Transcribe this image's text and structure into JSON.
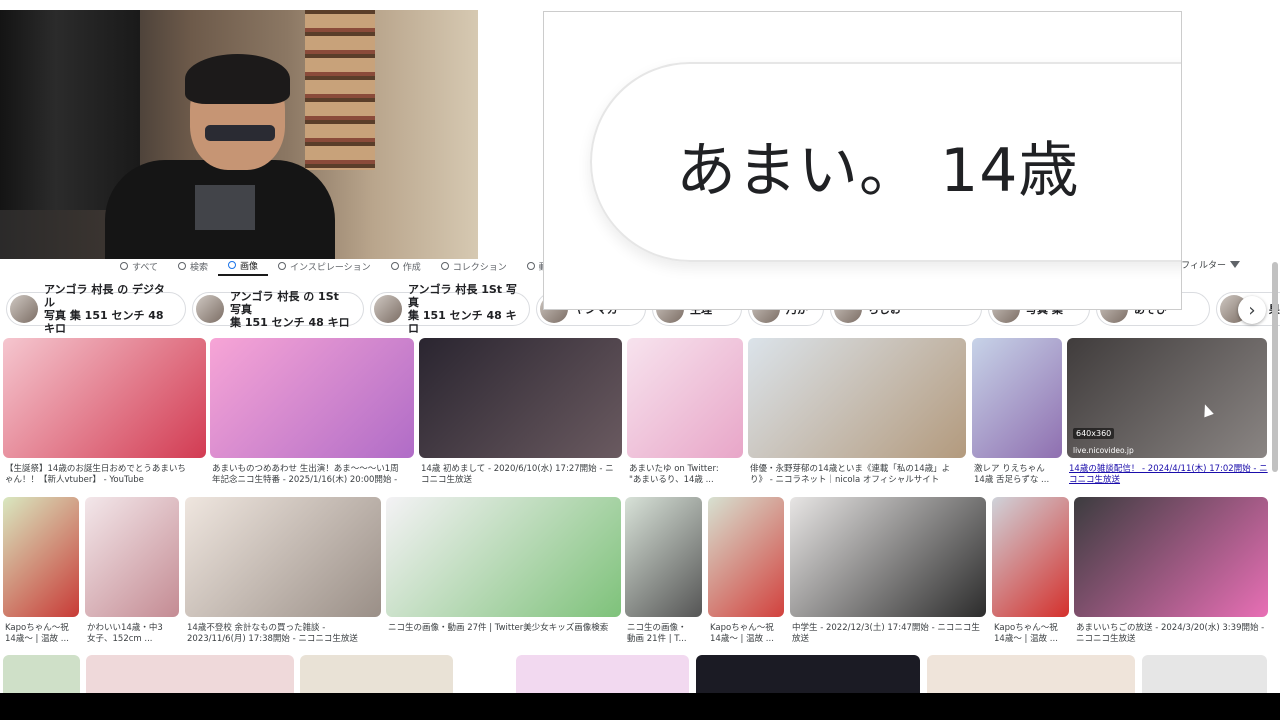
{
  "search_tabs": [
    {
      "label": "すべて",
      "icon": "search-icon"
    },
    {
      "label": "検索",
      "icon": "search-icon"
    },
    {
      "label": "画像",
      "icon": "image-icon",
      "active": true
    },
    {
      "label": "インスピレーション",
      "icon": "sparkle-icon"
    },
    {
      "label": "作成",
      "icon": "create-icon"
    },
    {
      "label": "コレクション",
      "icon": "collection-icon"
    },
    {
      "label": "動画",
      "icon": "video-icon"
    }
  ],
  "filters_label": "フィルター",
  "chips": [
    "アンゴラ 村長 の デジタル\n写真 集 151 センチ 48 キロ",
    "アンゴラ 村長 の 1St 写真\n集 151 センチ 48 キロ",
    "アンゴラ 村長 1St 写真\n集 151 センチ 48 キロ",
    "ヤンマガ",
    "生理",
    "乃か",
    "らじお",
    "写真 集",
    "あそび",
    "梨 果実"
  ],
  "row1": [
    {
      "caption": "【生誕祭】14歳のお誕生日おめでとうあまいち\nゃん！！【新人vtuber】 - YouTube",
      "colors": [
        "#f5c6cf",
        "#d23b52"
      ]
    },
    {
      "caption": "あまいものつめあわせ 生出演！あま〜〜〜い1周\n年記念ニコ生特番 - 2025/1/16(木) 20:00開始 -",
      "colors": [
        "#f7a5d6",
        "#b06cc7"
      ]
    },
    {
      "caption": "14歳 初めまして - 2020/6/10(水) 17:27開始 - ニ\nコニコ生放送",
      "colors": [
        "#2a2530",
        "#6a5a60"
      ]
    },
    {
      "caption": "あまいたゆ on Twitter:\n\"あまいるり、14歳 ...",
      "colors": [
        "#f7e3ee",
        "#e8a6c8"
      ]
    },
    {
      "caption": "俳優・永野芽郁の14歳といま《連載「私の14歳」よ\nり》 - ニコラネット｜nicola オフィシャルサイト",
      "colors": [
        "#dbe3ea",
        "#b39a7d"
      ]
    },
    {
      "caption": "激レア りえちゃん\n14歳 舌足らずな ...",
      "colors": [
        "#c7d3e8",
        "#8f6fb0"
      ]
    },
    {
      "caption": "14歳の雑談配信！ - 2024/4/11(木) 17:02開始 - ニ\nコニコ生放送",
      "colors": [
        "#403c3c",
        "#8a8583"
      ],
      "link": true,
      "badge": "640x360",
      "site": "live.nicovideo.jp"
    }
  ],
  "row2": [
    {
      "caption": "Kapoちゃん〜祝\n14歳〜 | 温故 ..."
    },
    {
      "caption": "かわいい14歳・中3\n女子、152cm ..."
    },
    {
      "caption": "14歳不登校 余計なもの買った雑談 -\n2023/11/6(月) 17:38開始 - ニコニコ生放送"
    },
    {
      "caption": "ニコ生の画像・動画 27件 | Twitter美少女キッズ画像検索"
    },
    {
      "caption": "ニコ生の画像・\n動画 21件 | T..."
    },
    {
      "caption": "Kapoちゃん〜祝\n14歳〜 | 温故 ..."
    },
    {
      "caption": "中学生 - 2022/12/3(土) 17:47開始 - ニコニコ生\n放送"
    },
    {
      "caption": "Kapoちゃん〜祝\n14歳〜 | 温故 ..."
    },
    {
      "caption": "あまいいちごの放送 - 2024/3/20(水) 3:39開始 -\nニコニコ生放送"
    }
  ],
  "zoom_query": "あまい。 14歳 ",
  "chips_next_icon": "chevron-right-icon"
}
